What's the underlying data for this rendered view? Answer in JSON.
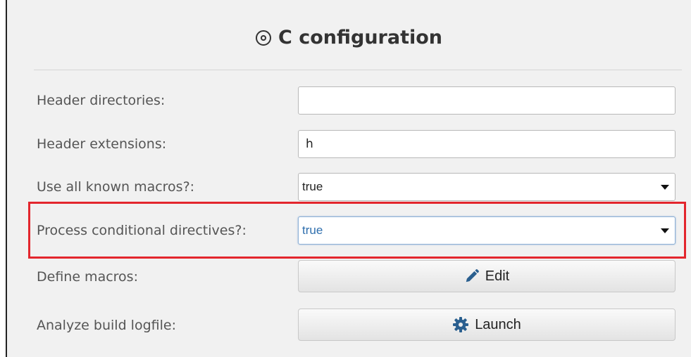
{
  "header": {
    "title": "C configuration",
    "icon": "target-icon"
  },
  "fields": {
    "header_directories": {
      "label": "Header directories:",
      "value": ""
    },
    "header_extensions": {
      "label": "Header extensions:",
      "value": "h"
    },
    "use_all_known_macros": {
      "label": "Use all known macros?:",
      "value": "true"
    },
    "process_conditional_directives": {
      "label": "Process conditional directives?:",
      "value": "true"
    },
    "define_macros": {
      "label": "Define macros:",
      "button_label": "Edit",
      "icon": "pencil-icon"
    },
    "analyze_build_logfile": {
      "label": "Analyze build logfile:",
      "button_label": "Launch",
      "icon": "gear-icon"
    }
  },
  "colors": {
    "highlight": "#e3262d",
    "focus_text": "#2f6fae",
    "panel_bg": "#f1f1f1"
  }
}
